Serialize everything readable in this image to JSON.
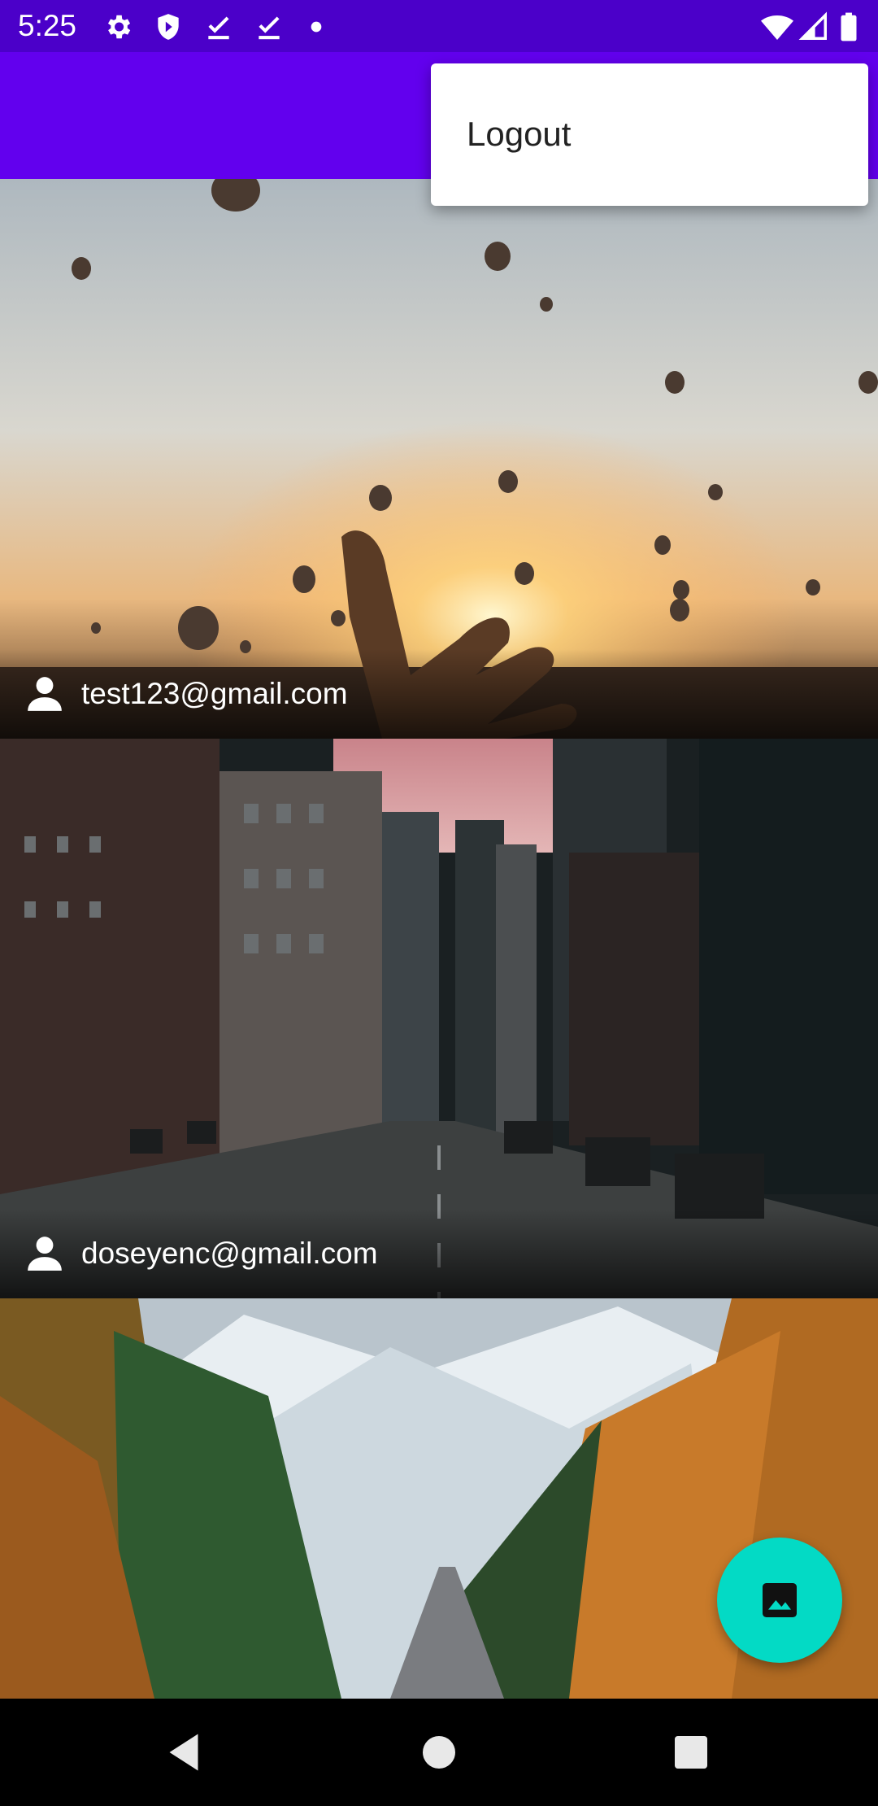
{
  "status_bar": {
    "time": "5:25",
    "left_icons": [
      "gear-icon",
      "shield-icon",
      "download-done-icon",
      "download-done-icon",
      "dot-icon"
    ],
    "right_icons": [
      "wifi-icon",
      "signal-icon",
      "battery-icon"
    ]
  },
  "app_bar": {
    "color": "#6200ee"
  },
  "overflow_menu": {
    "items": [
      {
        "label": "Logout"
      }
    ]
  },
  "feed": {
    "posts": [
      {
        "email": "test123@gmail.com",
        "image": "balloons-sunset-hand"
      },
      {
        "email": "doseyenc@gmail.com",
        "image": "city-street"
      },
      {
        "email": "",
        "image": "autumn-forest-road"
      }
    ]
  },
  "fab": {
    "icon": "image-icon",
    "color": "#03dac5"
  },
  "nav_bar": {
    "buttons": [
      "back-icon",
      "home-icon",
      "recents-icon"
    ]
  }
}
